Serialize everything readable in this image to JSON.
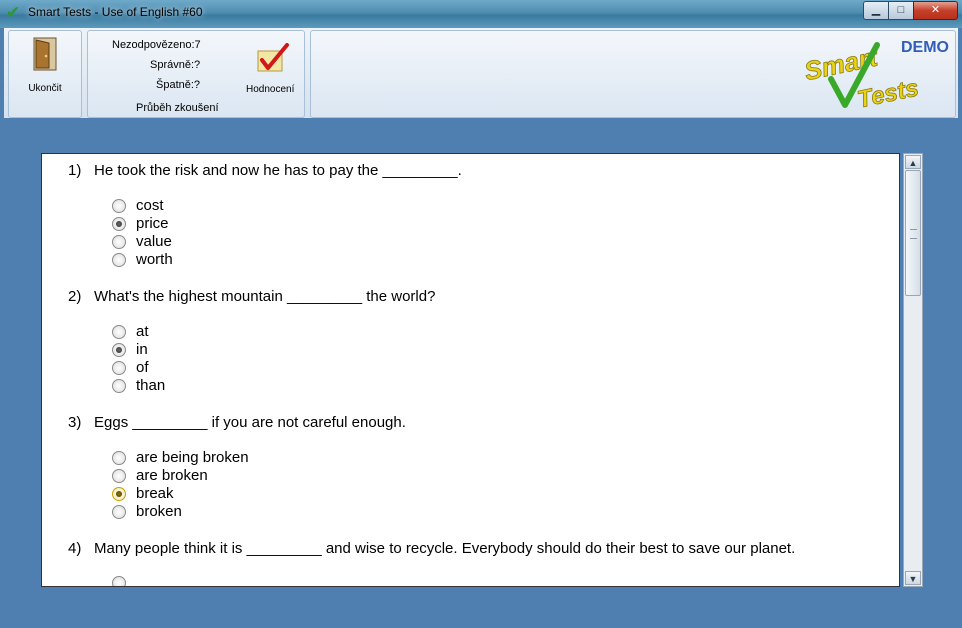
{
  "window": {
    "title": "Smart Tests - Use of English #60",
    "min_symbol": "▁",
    "max_symbol": "□",
    "close_symbol": "✕"
  },
  "toolbar": {
    "exit_label": "Ukončit",
    "unanswered": "Nezodpovězeno:7",
    "correct": "Správně:?",
    "wrong": "Špatně:?",
    "progress_label": "Průběh zkoušení",
    "evaluate_label": "Hodnocení",
    "demo": "DEMO"
  },
  "questions": [
    {
      "number": "1)",
      "text": "He took the risk and now he has to pay the _________.",
      "options": [
        {
          "label": "cost",
          "selected": false
        },
        {
          "label": "price",
          "selected": true
        },
        {
          "label": "value",
          "selected": false
        },
        {
          "label": "worth",
          "selected": false
        }
      ]
    },
    {
      "number": "2)",
      "text": "What's the highest mountain _________ the world?",
      "options": [
        {
          "label": "at",
          "selected": false
        },
        {
          "label": "in",
          "selected": true
        },
        {
          "label": "of",
          "selected": false
        },
        {
          "label": "than",
          "selected": false
        }
      ]
    },
    {
      "number": "3)",
      "text": "Eggs _________ if you are not careful enough.",
      "options": [
        {
          "label": "are being broken",
          "selected": false
        },
        {
          "label": "are broken",
          "selected": false
        },
        {
          "label": "break",
          "selected": true
        },
        {
          "label": "broken",
          "selected": false
        }
      ]
    },
    {
      "number": "4)",
      "text": "Many people think it is _________ and wise to recycle. Everybody should do their best to save our planet.",
      "options": []
    }
  ],
  "colors": {
    "demo": "#2f5fb8",
    "check_red": "#d01818",
    "logo_yellow": "#e8d21a",
    "logo_green": "#3aa828"
  }
}
